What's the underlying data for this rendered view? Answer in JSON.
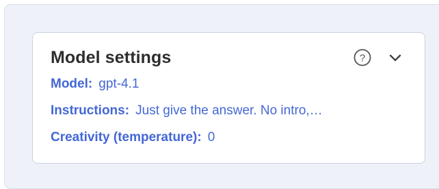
{
  "card": {
    "title": "Model settings",
    "help_icon": "question-circle-icon",
    "toggle_icon": "chevron-down-icon"
  },
  "fields": {
    "model": {
      "label": "Model:",
      "value": "gpt-4.1"
    },
    "instructions": {
      "label": "Instructions:",
      "value": "Just give the answer. No intro,…"
    },
    "creativity": {
      "label": "Creativity (temperature):",
      "value": "0"
    }
  },
  "colors": {
    "accent": "#4467d6",
    "title": "#2e2e2e",
    "panel_bg": "#eef2f8",
    "card_border": "#c9d2df",
    "icon": "#555555"
  }
}
